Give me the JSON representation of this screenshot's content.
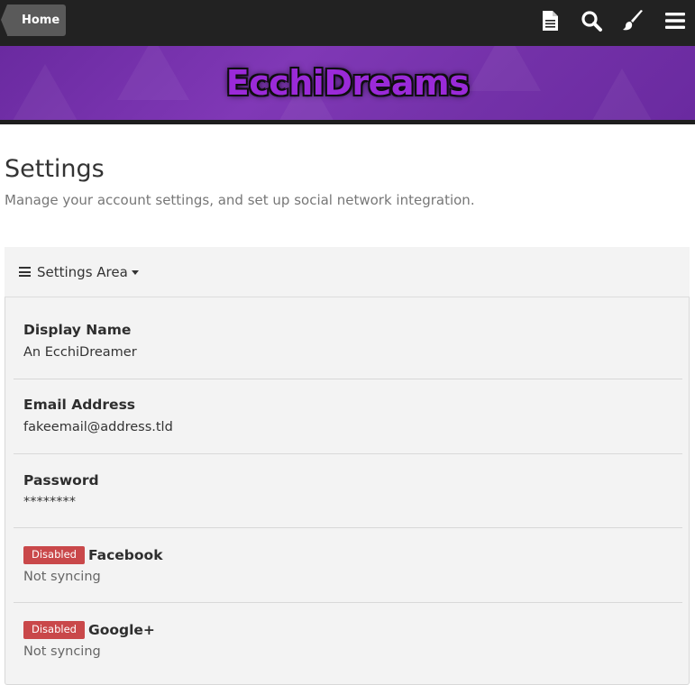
{
  "topbar": {
    "home_label": "Home",
    "icons": [
      "document-icon",
      "search-icon",
      "brush-icon",
      "menu-icon"
    ]
  },
  "banner": {
    "logo_text": "EcchiDreams"
  },
  "page": {
    "title": "Settings",
    "subtitle": "Manage your account settings, and set up social network integration."
  },
  "settings_area": {
    "label": "Settings Area"
  },
  "rows": [
    {
      "label": "Display Name",
      "value": "An EcchiDreamer"
    },
    {
      "label": "Email Address",
      "value": "fakeemail@address.tld"
    },
    {
      "label": "Password",
      "value": "********"
    },
    {
      "badge": "Disabled",
      "label": "Facebook",
      "value": "Not syncing"
    },
    {
      "badge": "Disabled",
      "label": "Google+",
      "value": "Not syncing"
    }
  ],
  "colors": {
    "topbar": "#222222",
    "banner": "#7331a8",
    "badge_disabled": "#c9484a"
  }
}
